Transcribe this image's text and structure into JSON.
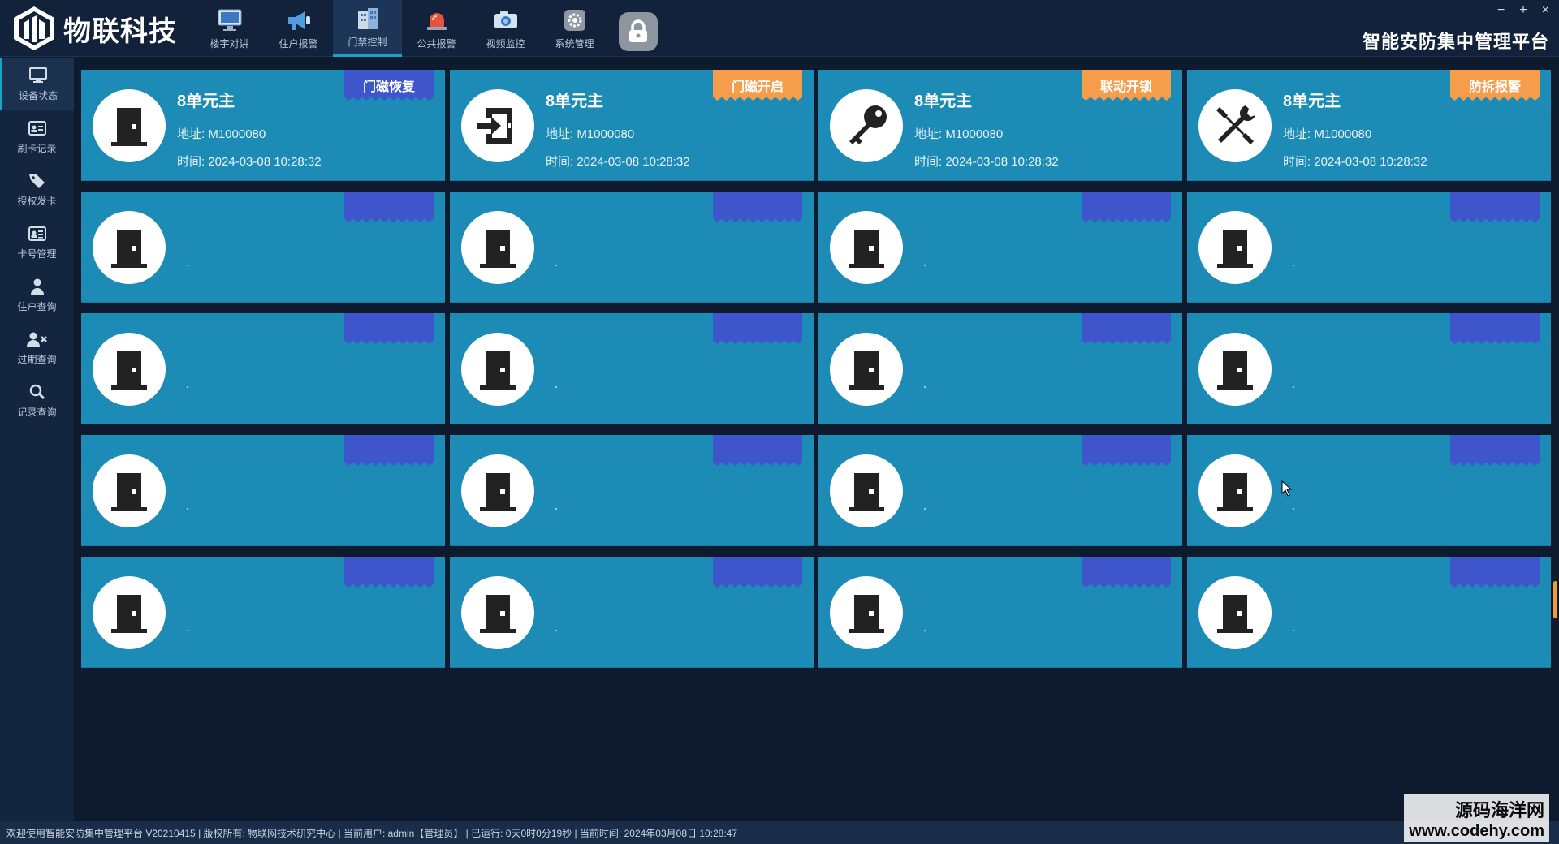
{
  "brand": {
    "name": "物联科技"
  },
  "nav": [
    {
      "label": "楼宇对讲",
      "icon": "monitor-icon",
      "active": false
    },
    {
      "label": "住户报警",
      "icon": "megaphone-icon",
      "active": false
    },
    {
      "label": "门禁控制",
      "icon": "building-icon",
      "active": true
    },
    {
      "label": "公共报警",
      "icon": "siren-icon",
      "active": false
    },
    {
      "label": "视频监控",
      "icon": "camera-icon",
      "active": false
    },
    {
      "label": "系统管理",
      "icon": "gear-icon",
      "active": false
    }
  ],
  "window": {
    "minimize": "−",
    "maximize": "+",
    "close": "×"
  },
  "platform_title": "智能安防集中管理平台",
  "sidebar": [
    {
      "label": "设备状态",
      "icon": "monitor-icon",
      "active": true
    },
    {
      "label": "刷卡记录",
      "icon": "id-card-icon",
      "active": false
    },
    {
      "label": "授权发卡",
      "icon": "tag-icon",
      "active": false
    },
    {
      "label": "卡号管理",
      "icon": "card-list-icon",
      "active": false
    },
    {
      "label": "住户查询",
      "icon": "user-icon",
      "active": false
    },
    {
      "label": "过期查询",
      "icon": "user-remove-icon",
      "active": false
    },
    {
      "label": "记录查询",
      "icon": "search-icon",
      "active": false
    }
  ],
  "cards_top": [
    {
      "name": "8单元主",
      "address": "地址: M1000080",
      "time": "时间: 2024-03-08 10:28:32",
      "tag": "门磁恢复",
      "tag_color": "#3e55cc",
      "icon": "door-closed-icon"
    },
    {
      "name": "8单元主",
      "address": "地址: M1000080",
      "time": "时间: 2024-03-08 10:28:32",
      "tag": "门磁开启",
      "tag_color": "#f59d4a",
      "icon": "door-enter-icon"
    },
    {
      "name": "8单元主",
      "address": "地址: M1000080",
      "time": "时间: 2024-03-08 10:28:32",
      "tag": "联动开锁",
      "tag_color": "#f59d4a",
      "icon": "key-icon"
    },
    {
      "name": "8单元主",
      "address": "地址: M1000080",
      "time": "时间: 2024-03-08 10:28:32",
      "tag": "防拆报警",
      "tag_color": "#f59d4a",
      "icon": "tools-icon"
    }
  ],
  "empty_card_count": 16,
  "colors": {
    "card_bg": "#1c8cb7",
    "tag_blue": "#3e55cc",
    "tag_orange": "#f59d4a",
    "accent": "#1aa3c8"
  },
  "status_bar": "欢迎使用智能安防集中管理平台 V20210415 | 版权所有: 物联网技术研究中心 | 当前用户: admin【管理员】 | 已运行: 0天0时0分19秒 | 当前时间: 2024年03月08日 10:28:47",
  "watermark": {
    "line1": "源码海洋网",
    "line2": "www.codehy.com"
  }
}
